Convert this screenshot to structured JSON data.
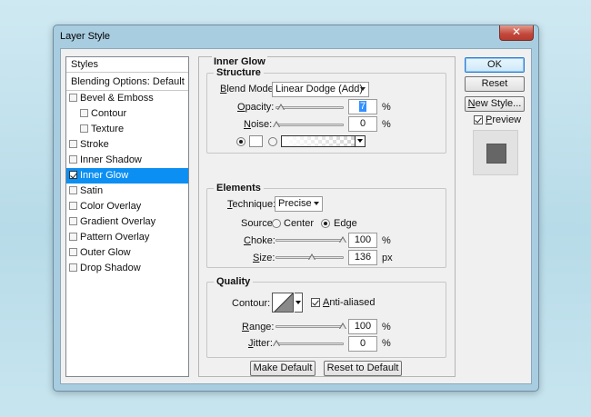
{
  "window": {
    "title": "Layer Style",
    "close_glyph": "✕"
  },
  "styles_panel": {
    "header": "Styles",
    "blending_options": "Blending Options: Default",
    "items": [
      {
        "label": "Bevel & Emboss",
        "checked": false,
        "indent": false,
        "selected": false
      },
      {
        "label": "Contour",
        "checked": false,
        "indent": true,
        "selected": false
      },
      {
        "label": "Texture",
        "checked": false,
        "indent": true,
        "selected": false
      },
      {
        "label": "Stroke",
        "checked": false,
        "indent": false,
        "selected": false
      },
      {
        "label": "Inner Shadow",
        "checked": false,
        "indent": false,
        "selected": false
      },
      {
        "label": "Inner Glow",
        "checked": true,
        "indent": false,
        "selected": true
      },
      {
        "label": "Satin",
        "checked": false,
        "indent": false,
        "selected": false
      },
      {
        "label": "Color Overlay",
        "checked": false,
        "indent": false,
        "selected": false
      },
      {
        "label": "Gradient Overlay",
        "checked": false,
        "indent": false,
        "selected": false
      },
      {
        "label": "Pattern Overlay",
        "checked": false,
        "indent": false,
        "selected": false
      },
      {
        "label": "Outer Glow",
        "checked": false,
        "indent": false,
        "selected": false
      },
      {
        "label": "Drop Shadow",
        "checked": false,
        "indent": false,
        "selected": false
      }
    ]
  },
  "inner_glow": {
    "title": "Inner Glow",
    "structure": {
      "label": "Structure",
      "blend_mode_prefix": "B",
      "blend_mode_rest": "lend Mode:",
      "blend_mode_value": "Linear Dodge (Add)",
      "opacity_prefix": "O",
      "opacity_rest": "pacity:",
      "opacity_value": "7",
      "opacity_unit": "%",
      "opacity_level": 0.07,
      "noise_prefix": "N",
      "noise_rest": "oise:",
      "noise_value": "0",
      "noise_unit": "%",
      "noise_level": 0.0,
      "color_swatch": "#ffffff"
    },
    "elements": {
      "label": "Elements",
      "technique_prefix": "T",
      "technique_rest": "echnique:",
      "technique_value": "Precise",
      "source_label": "Source:",
      "source_center": "Center",
      "source_edge": "Edge",
      "choke_prefix": "C",
      "choke_rest": "hoke:",
      "choke_value": "100",
      "choke_unit": "%",
      "choke_level": 1.0,
      "size_prefix": "S",
      "size_rest": "ize:",
      "size_value": "136",
      "size_unit": "px",
      "size_level": 0.54
    },
    "quality": {
      "label": "Quality",
      "contour_label": "Contour:",
      "anti_aliased_prefix": "A",
      "anti_aliased_rest": "nti-aliased",
      "anti_aliased_checked": true,
      "range_prefix": "R",
      "range_rest": "ange:",
      "range_value": "100",
      "range_unit": "%",
      "range_level": 1.0,
      "jitter_prefix": "J",
      "jitter_rest": "itter:",
      "jitter_value": "0",
      "jitter_unit": "%",
      "jitter_level": 0.0
    },
    "make_default": "Make Default",
    "reset_to_default": "Reset to Default"
  },
  "right_buttons": {
    "ok": "OK",
    "reset": "Reset",
    "new_style_prefix": "N",
    "new_style_rest": "ew Style...",
    "preview_prefix": "P",
    "preview_rest": "review",
    "preview_checked": true
  },
  "colors": {
    "selection": "#0c8ff2",
    "window_frame": "#a9cde0",
    "close_button": "#c2473a"
  }
}
